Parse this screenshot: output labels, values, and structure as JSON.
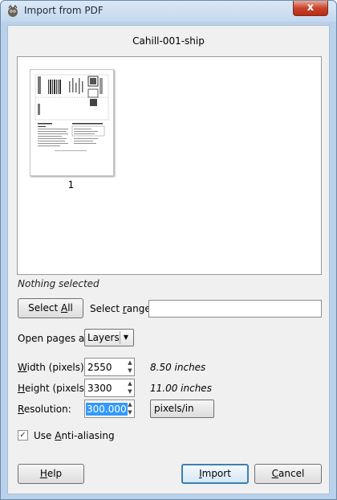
{
  "window": {
    "title": "Import from PDF",
    "close_glyph": "x"
  },
  "document": {
    "name": "Cahill-001-ship",
    "pages": [
      {
        "number": "1"
      }
    ]
  },
  "selection_status": "Nothing selected",
  "select_all_button": {
    "label_pre": "Select ",
    "label_accel": "A",
    "label_post": "ll"
  },
  "select_range": {
    "label_pre": "Select ",
    "label_accel": "r",
    "label_post": "ange:",
    "value": ""
  },
  "open_pages_as": {
    "label": "Open pages as",
    "selected": "Layers"
  },
  "width": {
    "label_accel": "W",
    "label_post": "idth (pixels):",
    "value": "2550",
    "unit_text": "8.50 inches"
  },
  "height": {
    "label_accel": "H",
    "label_post": "eight (pixels):",
    "value": "3300",
    "unit_text": "11.00 inches"
  },
  "resolution": {
    "label_accel": "R",
    "label_post": "esolution:",
    "value": "300.000",
    "unit": "pixels/in"
  },
  "anti_aliasing": {
    "label_pre": "Use ",
    "label_accel": "A",
    "label_post": "nti-aliasing",
    "checked": true
  },
  "buttons": {
    "help": {
      "label_accel": "H",
      "label_post": "elp"
    },
    "import": {
      "label_accel": "I",
      "label_post": "mport"
    },
    "cancel": {
      "label_accel": "C",
      "label_post": "ancel"
    }
  }
}
